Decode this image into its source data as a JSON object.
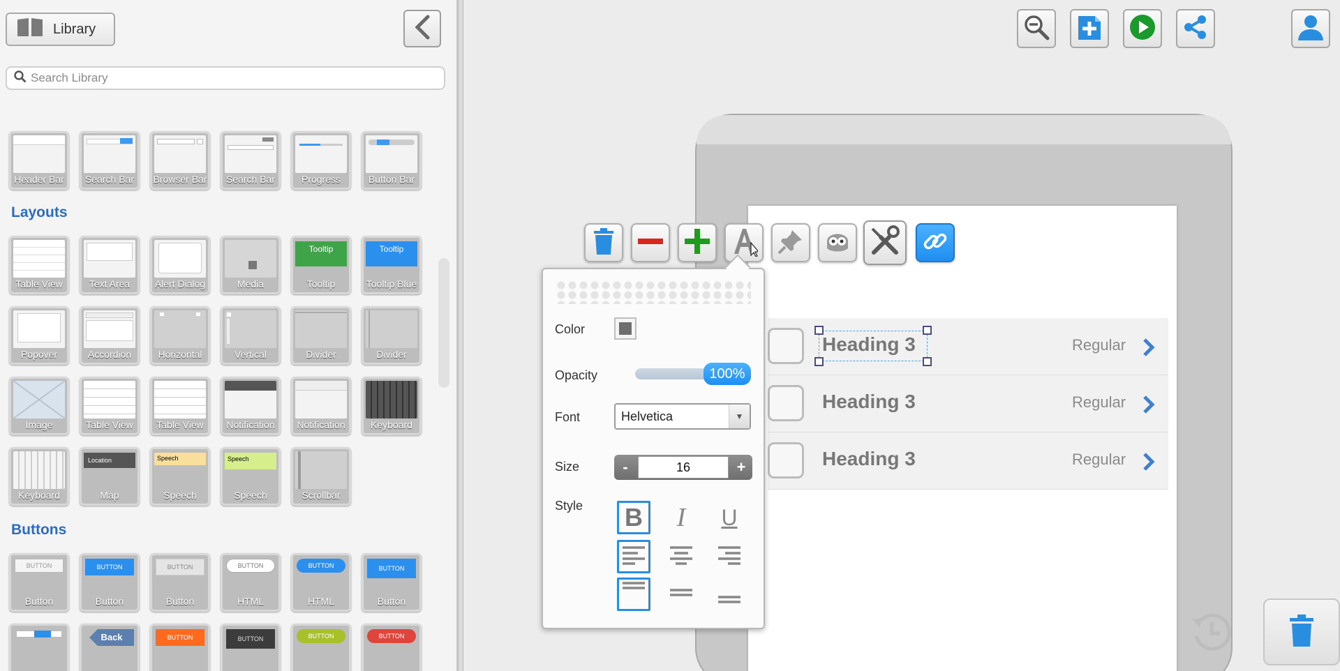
{
  "library": {
    "button_label": "Library",
    "search_placeholder": "Search Library",
    "bars": [
      "Header Bar",
      "Search Bar",
      "Browser Bar",
      "Search Bar",
      "Progress",
      "Button Bar"
    ],
    "layouts_title": "Layouts",
    "layouts_row1": [
      "Table View",
      "Text Area",
      "Alert Dialog",
      "Media",
      "Tooltip",
      "Tooltip Blue"
    ],
    "layouts_row2": [
      "Popover",
      "Accordion",
      "Horizontal",
      "Vertical",
      "Divider",
      "Divider"
    ],
    "layouts_row3": [
      "Image",
      "Table View",
      "Table View",
      "Notification",
      "Notification",
      "Keyboard"
    ],
    "layouts_row4": [
      "Keyboard",
      "Map",
      "Speech",
      "Speech",
      "Scrollbar"
    ],
    "buttons_title": "Buttons",
    "buttons_row1": [
      "Button",
      "Button",
      "Button",
      "HTML",
      "HTML",
      "Button"
    ],
    "buttons_row2": [
      "",
      "Back",
      "BUTTON",
      "BUTTON",
      "BUTTON",
      "BUTTON"
    ],
    "thumb_text": {
      "tooltip": "Tooltip",
      "tooltip_blue": "Tooltip",
      "button_text": "BUTTON",
      "map_location": "Location",
      "speech": "Speech"
    }
  },
  "canvas": {
    "rows": [
      {
        "heading": "Heading 3",
        "detail": "Regular"
      },
      {
        "heading": "Heading 3",
        "detail": "Regular"
      },
      {
        "heading": "Heading 3",
        "detail": "Regular"
      }
    ]
  },
  "props": {
    "color_label": "Color",
    "opacity_label": "Opacity",
    "opacity_value": "100%",
    "font_label": "Font",
    "font_value": "Helvetica",
    "size_label": "Size",
    "size_value": "16",
    "size_minus": "-",
    "size_plus": "+",
    "style_label": "Style",
    "style_bold": "B",
    "style_italic": "I",
    "style_underline": "U"
  },
  "colors": {
    "accent_blue": "#2a8ee0",
    "play_green": "#1a9a2a",
    "remove_red": "#d9261c",
    "add_green": "#1f9b1f",
    "section_title": "#2a6cc4"
  }
}
